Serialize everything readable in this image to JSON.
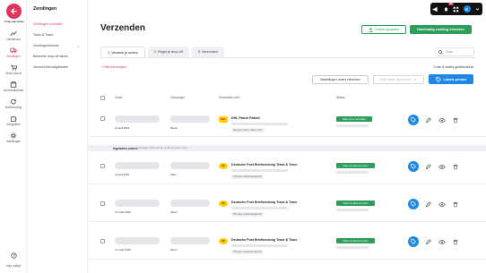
{
  "rail": {
    "back_label": "Terug naar admin",
    "items": [
      {
        "label": "Dashboard",
        "icon": "chart-line-icon"
      },
      {
        "label": "Zendingen",
        "icon": "truck-icon",
        "active": true
      },
      {
        "label": "Order import",
        "icon": "cart-icon"
      },
      {
        "label": "Voorraadbeheer",
        "icon": "box-icon"
      },
      {
        "label": "Boekhouding",
        "icon": "refresh-icon"
      },
      {
        "label": "Integraties",
        "icon": "puzzle-icon"
      },
      {
        "label": "Instellingen",
        "icon": "gear-icon"
      }
    ],
    "help_label": "Hulp nodig?"
  },
  "sidebar": {
    "title": "Zendingen",
    "items": [
      {
        "label": "Zendingen overzicht",
        "active": true
      },
      {
        "label": "Track & Trace"
      },
      {
        "label": "Zendingenhistorie"
      },
      {
        "label": "Bewerkte drop-off labels"
      },
      {
        "label": "Verzend benodigdheden"
      }
    ]
  },
  "topbar": {
    "badge": "99+",
    "avatar": "R"
  },
  "header": {
    "title": "Verzenden",
    "upload_label": "Orders uploaden",
    "new_label": "Handmatig zending inboeken"
  },
  "tabs": [
    {
      "label": "1. Verwerk je orders",
      "active": true
    },
    {
      "label": "2. Regel je drop off"
    },
    {
      "label": "3. Verzonden"
    }
  ],
  "search": {
    "placeholder": "Zoek"
  },
  "toolbar": {
    "filters_label": "+ Filter toevoegen",
    "count_text": "0 van 8 orders geselecteerd",
    "refresh_label": "Bestellingen orders refreshen",
    "bulk_label": "Bulk delete verzenden",
    "print_label": "Labels printen"
  },
  "table": {
    "headers": {
      "order": "Order",
      "receiver": "Ontvanger",
      "shipping": "Verzenden met",
      "status": "Status"
    },
    "section": {
      "title": "Ingeladen orders",
      "note": "(verborgen orders komen na 48 uur binnen mijn)"
    },
    "rows": [
      {
        "date": "14 april 2025",
        "receiver": "Boxtel",
        "carrier": "DHL Parcel Pakket",
        "carrier_short": "DHL",
        "carrier_color": "#ffcc00",
        "carrier_text_color": "#d40511",
        "meta": "1kg gram, 15cm x 15cm x 5cm",
        "status": "Klaar om te verzenden"
      },
      {
        "date": "11 april 2025",
        "receiver": "Parle",
        "carrier": "Deutsche Post Briefsendung Track & Trace",
        "carrier_short": "DP",
        "carrier_color": "#ffcc00",
        "carrier_text_color": "#333",
        "meta": "275 gram, briefsendungsrecht",
        "status": "Klaar om label te printen"
      },
      {
        "date": "11 maart 2025",
        "receiver": "Weert",
        "carrier": "Deutsche Post Briefsendung Track & Trace",
        "carrier_short": "DP",
        "carrier_color": "#ffcc00",
        "carrier_text_color": "#333",
        "meta": "275 gram, briefsendungsrecht",
        "status": "Klaar om label te printen"
      },
      {
        "date": "11 maart 2025",
        "receiver": "Weert",
        "carrier": "Deutsche Post Briefsendung Track & Trace",
        "carrier_short": "DP",
        "carrier_color": "#ffcc00",
        "carrier_text_color": "#333",
        "meta": "275 gram, briefsendungsrecht",
        "status": "Klaar om label te printen"
      }
    ]
  },
  "colors": {
    "accent": "#e2335a",
    "green": "#2e9e5b",
    "blue": "#1e88e5"
  }
}
